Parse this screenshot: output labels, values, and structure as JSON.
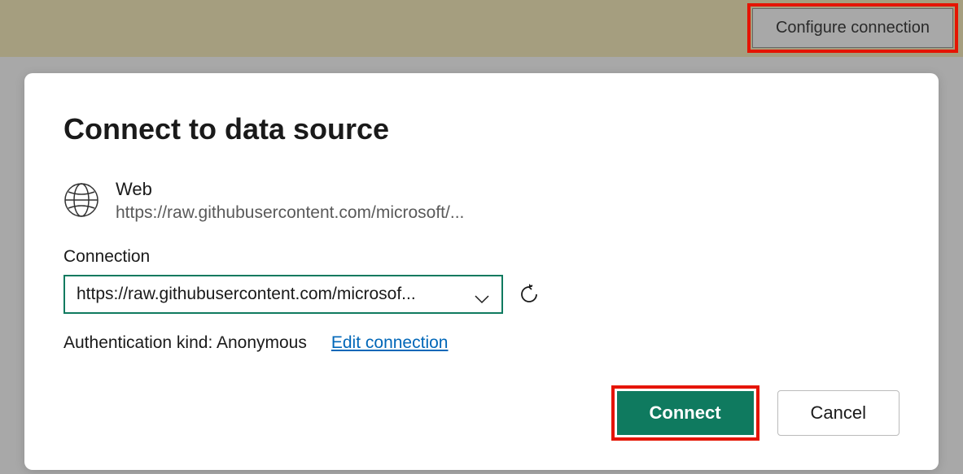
{
  "topbar": {
    "configure_label": "Configure connection"
  },
  "dialog": {
    "title": "Connect to data source",
    "source": {
      "type": "Web",
      "url": "https://raw.githubusercontent.com/microsoft/..."
    },
    "connection": {
      "label": "Connection",
      "selected_value": "https://raw.githubusercontent.com/microsof..."
    },
    "auth": {
      "text": "Authentication kind: Anonymous",
      "edit_label": "Edit connection"
    },
    "buttons": {
      "connect": "Connect",
      "cancel": "Cancel"
    }
  }
}
